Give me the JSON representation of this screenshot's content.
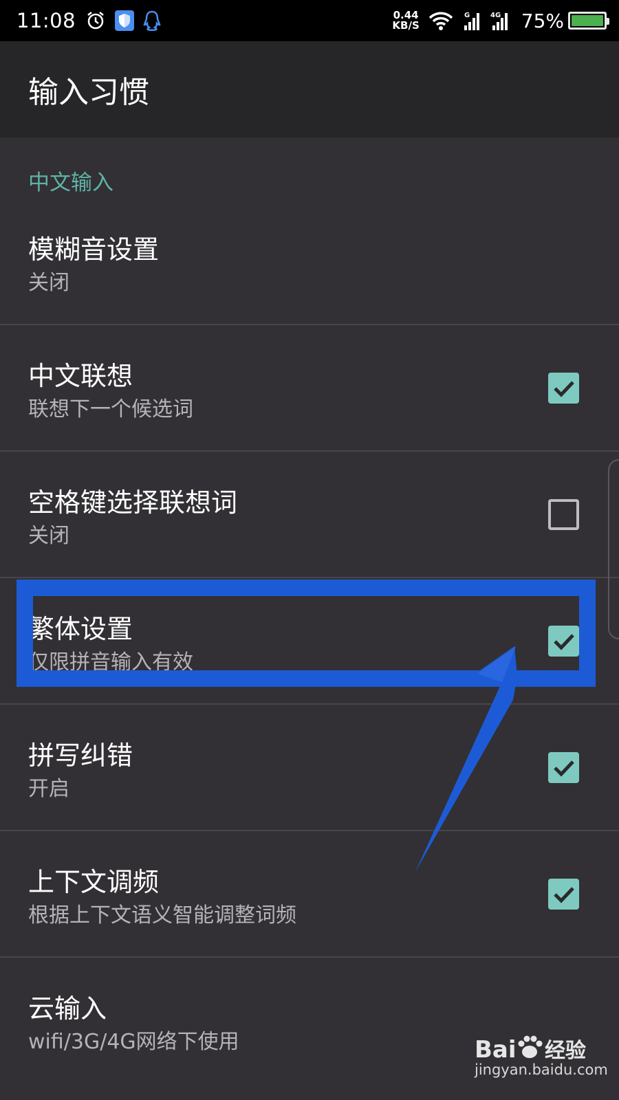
{
  "status_bar": {
    "time": "11:08",
    "net_speed_value": "0.44",
    "net_speed_unit": "KB/S",
    "battery_percent": "75%",
    "icons": [
      "alarm-icon",
      "shield-icon",
      "qq-penguin-icon",
      "wifi-icon",
      "signal-g-icon",
      "signal-4g-icon",
      "battery-icon"
    ]
  },
  "header": {
    "title": "输入习惯"
  },
  "section": {
    "label": "中文输入"
  },
  "items": [
    {
      "title": "模糊音设置",
      "subtitle": "关闭",
      "checkbox": null
    },
    {
      "title": "中文联想",
      "subtitle": "联想下一个候选词",
      "checkbox": true
    },
    {
      "title": "空格键选择联想词",
      "subtitle": "关闭",
      "checkbox": false
    },
    {
      "title": "繁体设置",
      "subtitle": "仅限拼音输入有效",
      "checkbox": true
    },
    {
      "title": "拼写纠错",
      "subtitle": "开启",
      "checkbox": true
    },
    {
      "title": "上下文调频",
      "subtitle": "根据上下文语义智能调整词频",
      "checkbox": true
    },
    {
      "title": "云输入",
      "subtitle": "wifi/3G/4G网络下使用",
      "checkbox": null
    }
  ],
  "colors": {
    "accent": "#7ecac0",
    "section_label": "#5fb3a8",
    "annotation_blue": "#1d5bd6",
    "background": "#323034",
    "header_bg": "#262628"
  },
  "watermark": {
    "logo": "Bai🐾经验",
    "url": "jingyan.baidu.com"
  }
}
